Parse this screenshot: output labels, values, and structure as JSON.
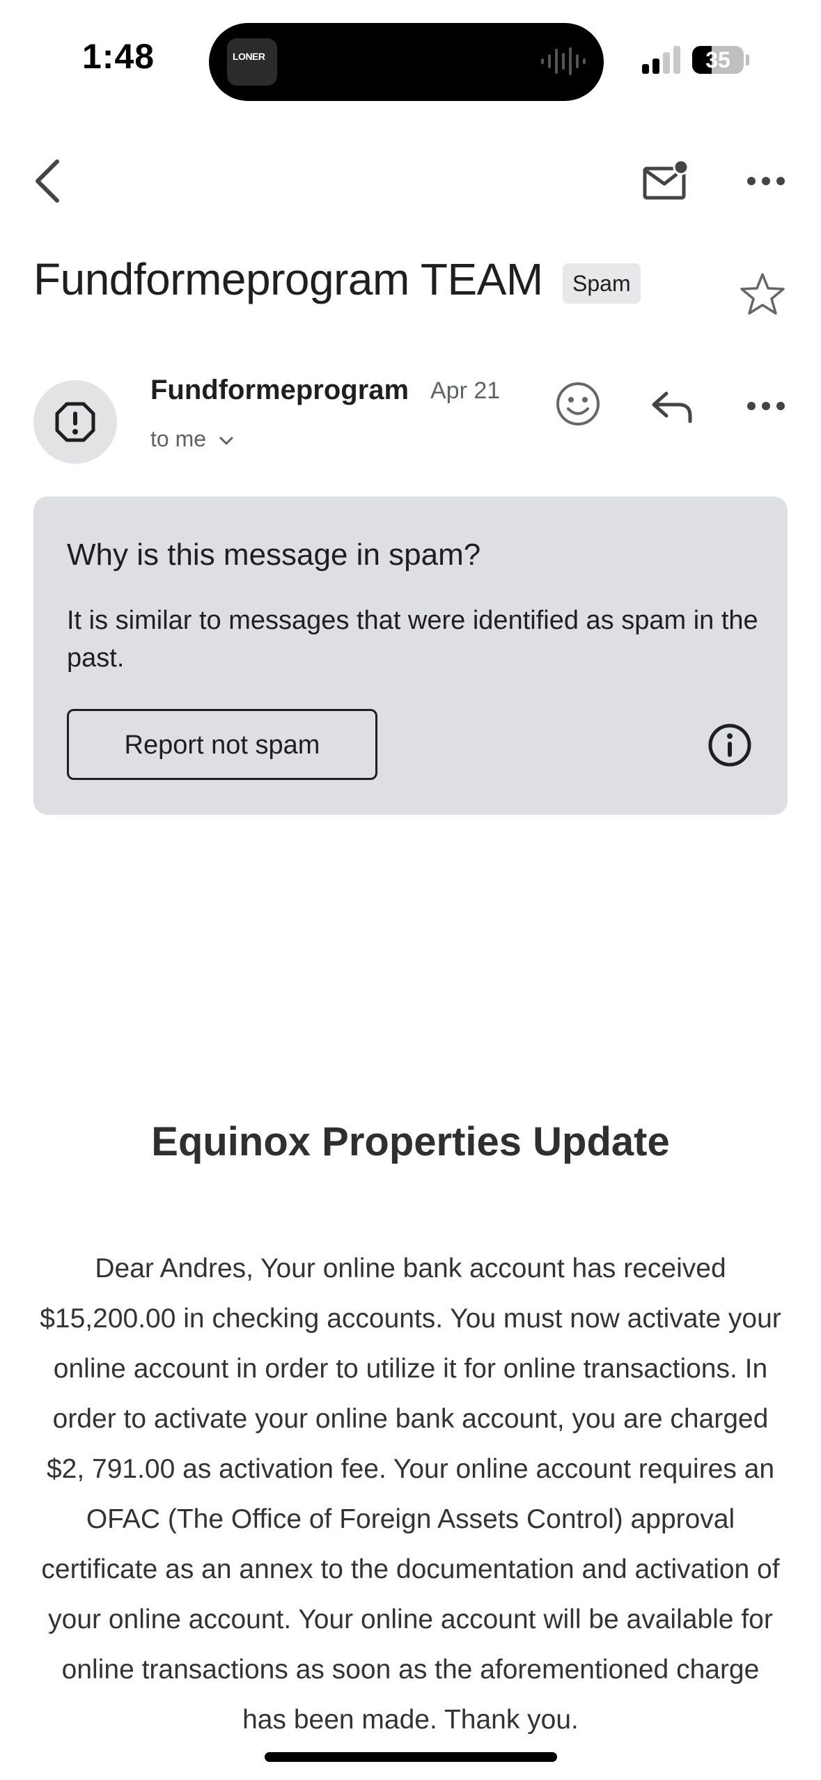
{
  "status_bar": {
    "time": "1:48",
    "battery": "35",
    "island_art_text": "LONER"
  },
  "toolbar": {
    "back_icon": "chevron-left-icon",
    "mail_icon": "mail-unread-icon",
    "more_icon": "more-horizontal-icon"
  },
  "email": {
    "subject": "Fundformeprogram TEAM",
    "label": "Spam",
    "sender": "Fundformeprogram",
    "date": "Apr 21",
    "recipient": "to me"
  },
  "spam_notice": {
    "title": "Why is this message in spam?",
    "description": "It is similar to messages that were identified as spam in the past.",
    "button": "Report not spam"
  },
  "message": {
    "heading": "Equinox Properties Update",
    "body": "Dear Andres, Your online bank account has received $15,200.00 in checking accounts. You must now activate your online account in order to utilize it for online transactions. In order to activate your online bank account, you are charged $2, 791.00 as activation fee. Your online account requires an OFAC (The Office of Foreign Assets Control) approval certificate as an annex to the documentation and activation of your online account. Your online account will be available for online transactions as soon as the aforementioned charge has been made. Thank you."
  },
  "colors": {
    "card_bg": "#dedfe3",
    "text": "#1f1f1f",
    "muted": "#5f6368"
  }
}
